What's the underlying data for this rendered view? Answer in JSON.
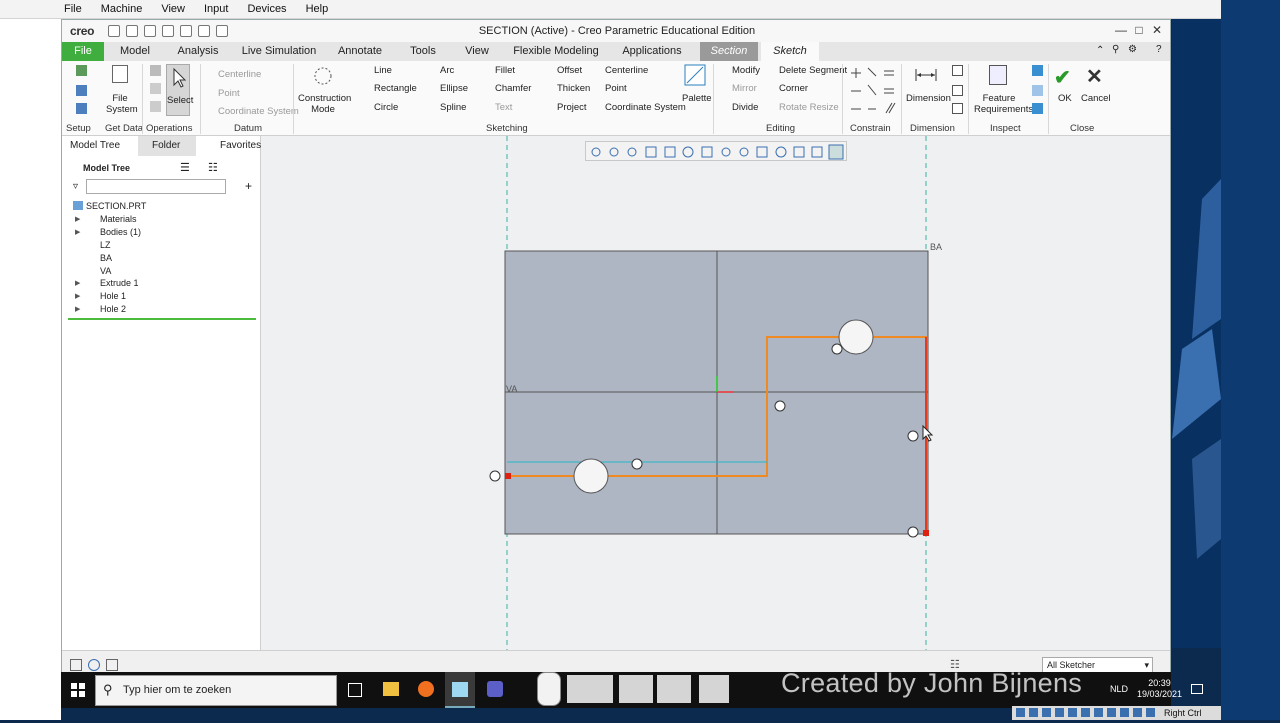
{
  "host_menu": [
    "File",
    "Machine",
    "View",
    "Input",
    "Devices",
    "Help"
  ],
  "window": {
    "title": "SECTION (Active) - Creo Parametric Educational Edition",
    "logo": "creo"
  },
  "tabs": [
    "File",
    "Model",
    "Analysis",
    "Live Simulation",
    "Annotate",
    "Tools",
    "View",
    "Flexible Modeling",
    "Applications",
    "Section",
    "Sketch"
  ],
  "ribbon": {
    "setup": {
      "file_system": "File System",
      "setup": "Setup",
      "get_data": "Get Data"
    },
    "operations": {
      "select": "Select",
      "label": "Operations"
    },
    "datum": {
      "centerline": "Centerline",
      "point": "Point",
      "coordinate_system": "Coordinate System",
      "label": "Datum"
    },
    "construction_mode": "Construction Mode",
    "sketching": {
      "line": "Line",
      "arc": "Arc",
      "fillet": "Fillet",
      "offset": "Offset",
      "centerline": "Centerline",
      "rectangle": "Rectangle",
      "ellipse": "Ellipse",
      "chamfer": "Chamfer",
      "thicken": "Thicken",
      "point": "Point",
      "circle": "Circle",
      "spline": "Spline",
      "text": "Text",
      "project": "Project",
      "coordinate_system": "Coordinate System",
      "palette": "Palette",
      "label": "Sketching"
    },
    "editing": {
      "modify": "Modify",
      "delete_segment": "Delete Segment",
      "mirror": "Mirror",
      "corner": "Corner",
      "divide": "Divide",
      "rotate_resize": "Rotate Resize",
      "label": "Editing"
    },
    "constrain": {
      "label": "Constrain"
    },
    "dimension": {
      "dimension": "Dimension",
      "label": "Dimension"
    },
    "inspect": {
      "feature_requirements": "Feature Requirements",
      "label": "Inspect"
    },
    "close": {
      "ok": "OK",
      "cancel": "Cancel",
      "label": "Close"
    }
  },
  "left_panel": {
    "tabs": [
      "Model Tree",
      "Folder Bro",
      "Favorites"
    ],
    "header": "Model Tree",
    "search_value": "",
    "items": [
      "SECTION.PRT",
      "Materials",
      "Bodies (1)",
      "LZ",
      "BA",
      "VA",
      "Extrude 1",
      "Hole 1",
      "Hole 2"
    ]
  },
  "canvas": {
    "label_ba": "BA",
    "label_va": "VA"
  },
  "status": {
    "filter": "All Sketcher"
  },
  "taskbar": {
    "search_placeholder": "Typ hier om te zoeken",
    "time": "20:39",
    "date": "19/03/2021",
    "lang": "NLD",
    "right_ctrl": "Right Ctrl"
  },
  "watermark": "Created by John Bijnens"
}
